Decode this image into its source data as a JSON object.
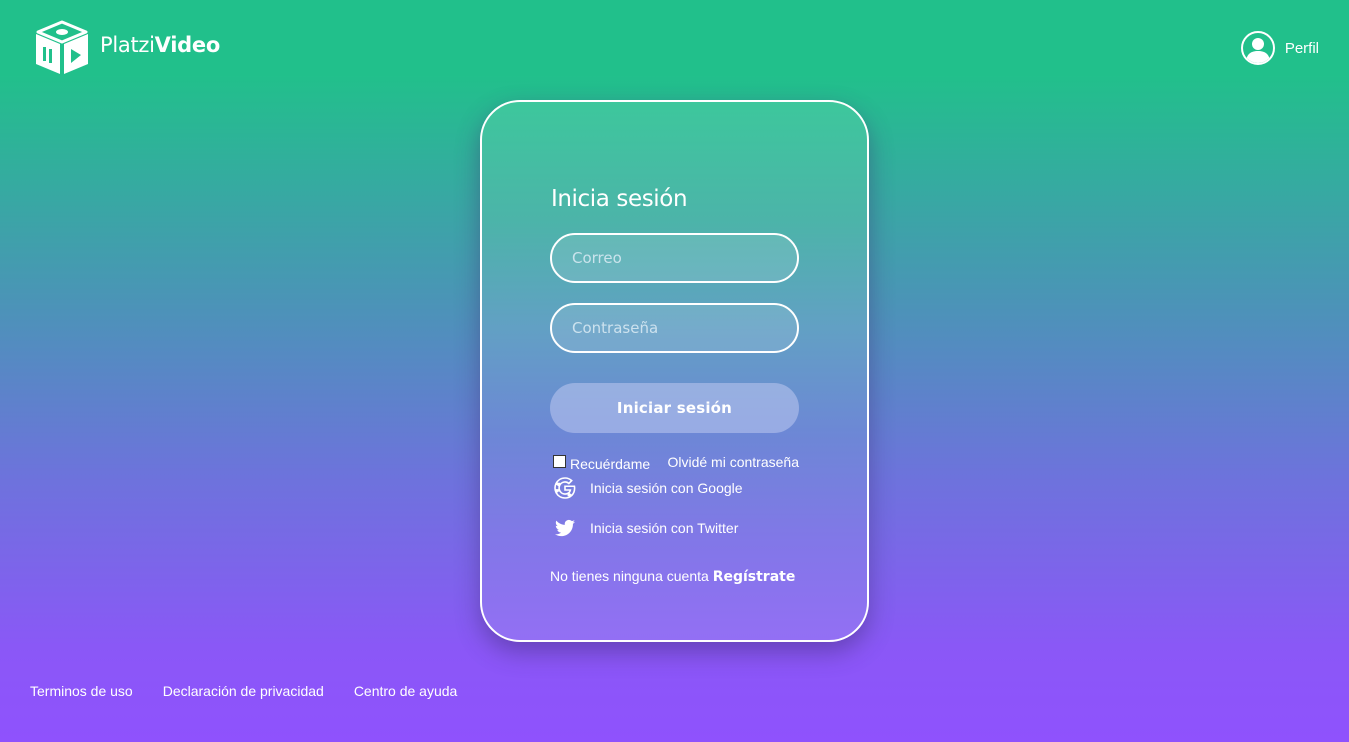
{
  "header": {
    "logo": {
      "icon": "platzi-video-cube-icon",
      "text_light": "Platzi",
      "text_bold": "Video"
    },
    "profile": {
      "icon": "user-avatar-icon",
      "label": "Perfil"
    }
  },
  "login": {
    "title": "Inicia sesión",
    "email": {
      "placeholder": "Correo",
      "value": ""
    },
    "password": {
      "placeholder": "Contraseña",
      "value": ""
    },
    "submit_label": "Iniciar sesión",
    "remember": {
      "label": "Recuérdame",
      "checked": false
    },
    "forgot_label": "Olvidé mi contraseña",
    "social": [
      {
        "icon": "google-icon",
        "label": "Inicia sesión con Google"
      },
      {
        "icon": "twitter-icon",
        "label": "Inicia sesión con Twitter"
      }
    ],
    "register": {
      "prompt": "No tienes ninguna cuenta ",
      "link_label": "Regístrate"
    }
  },
  "footer": {
    "links": [
      "Terminos de uso",
      "Declaración de privacidad",
      "Centro de ayuda"
    ]
  },
  "colors": {
    "gradient_top": "#21c08b",
    "gradient_middle": "#6e72dd",
    "gradient_bottom": "#8f52fd",
    "text": "#ffffff"
  }
}
